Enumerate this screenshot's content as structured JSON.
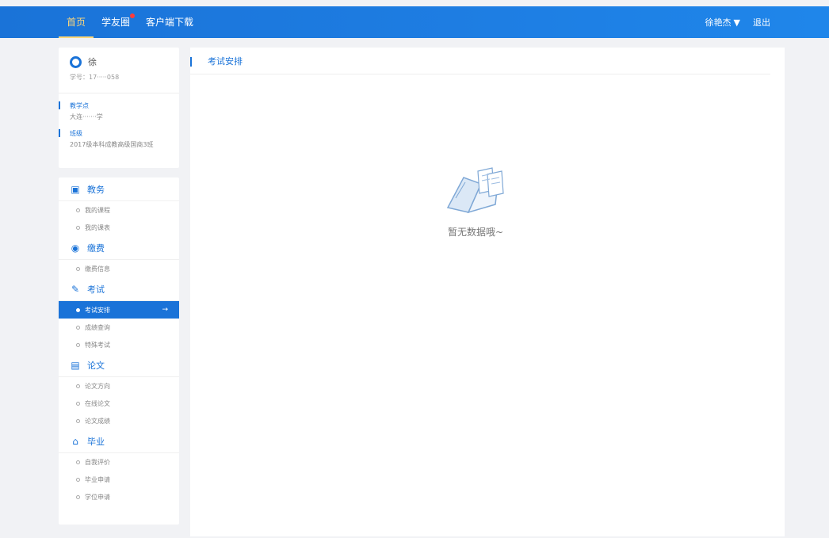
{
  "topnav": {
    "items": [
      {
        "label": "首页",
        "active": true
      },
      {
        "label": "学友圈",
        "badge": true
      },
      {
        "label": "客户端下载"
      }
    ],
    "user_menu": "徐艳杰",
    "logout": "退出"
  },
  "user_card": {
    "name": "徐",
    "student_id": "学号：17·····058",
    "info": [
      {
        "label": "教学点",
        "value": "大连·······学"
      },
      {
        "label": "班级",
        "value": "2017级本科成教高级国商3班"
      }
    ]
  },
  "sidebar": {
    "groups": [
      {
        "title": "教务",
        "icon": "calendar-icon",
        "items": [
          "我的课程",
          "我的课表"
        ]
      },
      {
        "title": "缴费",
        "icon": "coin-icon",
        "items": [
          "缴费信息"
        ]
      },
      {
        "title": "考试",
        "icon": "pencil-icon",
        "items": [
          "考试安排",
          "成绩查询",
          "特殊考试"
        ],
        "active_index": 0
      },
      {
        "title": "论文",
        "icon": "clipboard-icon",
        "items": [
          "论文方向",
          "在线论文",
          "论文成绩"
        ]
      },
      {
        "title": "毕业",
        "icon": "graduation-cap-icon",
        "items": [
          "自我评价",
          "毕业申请",
          "学位申请"
        ]
      }
    ]
  },
  "content": {
    "title": "考试安排",
    "empty_text": "暂无数据哦~"
  },
  "colors": {
    "accent": "#1a73d8",
    "active_nav": "#ffd87a",
    "badge": "#ff3b3b"
  }
}
